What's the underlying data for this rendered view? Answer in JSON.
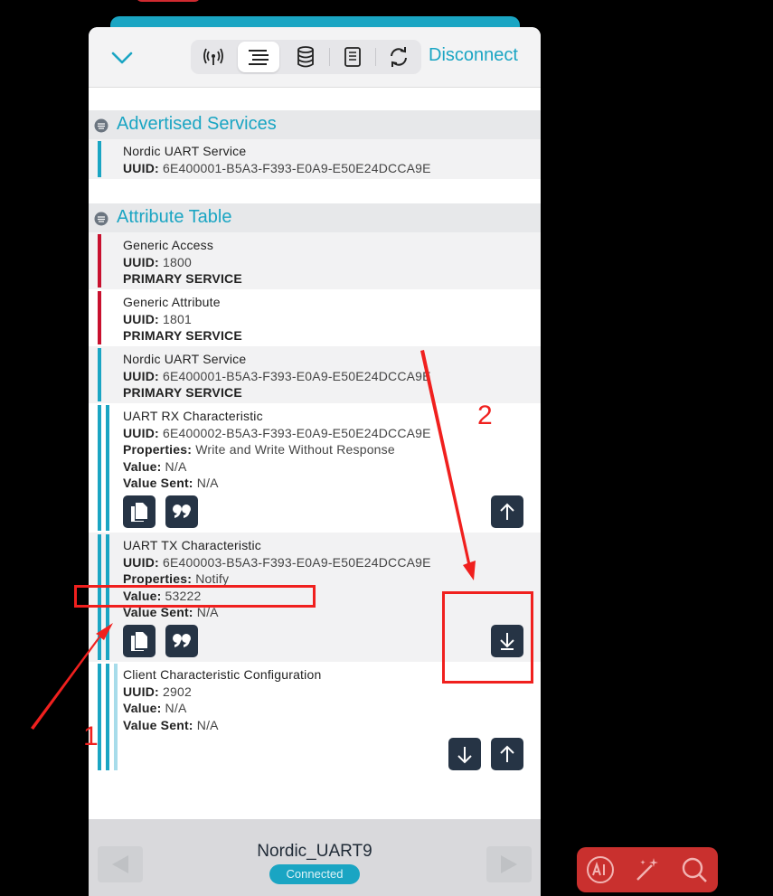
{
  "header": {
    "disconnect_label": "Disconnect"
  },
  "sections": {
    "advertised_title": "Advertised Services",
    "attribute_title": "Attribute Table"
  },
  "advertised": {
    "name": "Nordic UART Service",
    "uuid_label": "UUID:",
    "uuid": "6E400001-B5A3-F393-E0A9-E50E24DCCA9E"
  },
  "attributes": {
    "generic_access": {
      "name": "Generic Access",
      "uuid_label": "UUID:",
      "uuid": "1800",
      "type": "PRIMARY SERVICE"
    },
    "generic_attribute": {
      "name": "Generic Attribute",
      "uuid_label": "UUID:",
      "uuid": "1801",
      "type": "PRIMARY SERVICE"
    },
    "nordic_uart": {
      "name": "Nordic UART Service",
      "uuid_label": "UUID:",
      "uuid": "6E400001-B5A3-F393-E0A9-E50E24DCCA9E",
      "type": "PRIMARY SERVICE"
    },
    "rx": {
      "name": "UART RX Characteristic",
      "uuid_label": "UUID:",
      "uuid": "6E400002-B5A3-F393-E0A9-E50E24DCCA9E",
      "properties_label": "Properties:",
      "properties": "Write and Write Without Response",
      "value_label": "Value:",
      "value": "N/A",
      "sent_label": "Value Sent:",
      "sent": "N/A"
    },
    "tx": {
      "name": "UART TX Characteristic",
      "uuid_label": "UUID:",
      "uuid": "6E400003-B5A3-F393-E0A9-E50E24DCCA9E",
      "properties_label": "Properties:",
      "properties": "Notify",
      "value_label": "Value:",
      "value": "53222",
      "sent_label": "Value Sent:",
      "sent": "N/A"
    },
    "cccd": {
      "name": "Client Characteristic Configuration",
      "uuid_label": "UUID:",
      "uuid": "2902",
      "value_label": "Value:",
      "value": "N/A",
      "sent_label": "Value Sent:",
      "sent": "N/A"
    }
  },
  "footer": {
    "device_name": "Nordic_UART9",
    "status": "Connected"
  },
  "annotations": {
    "label_1": "1",
    "label_2": "2"
  },
  "colors": {
    "accent": "#1aa5c3",
    "service_bar_red": "#c8102e",
    "button_dark": "#263445",
    "annotation_red": "#f0201e"
  }
}
